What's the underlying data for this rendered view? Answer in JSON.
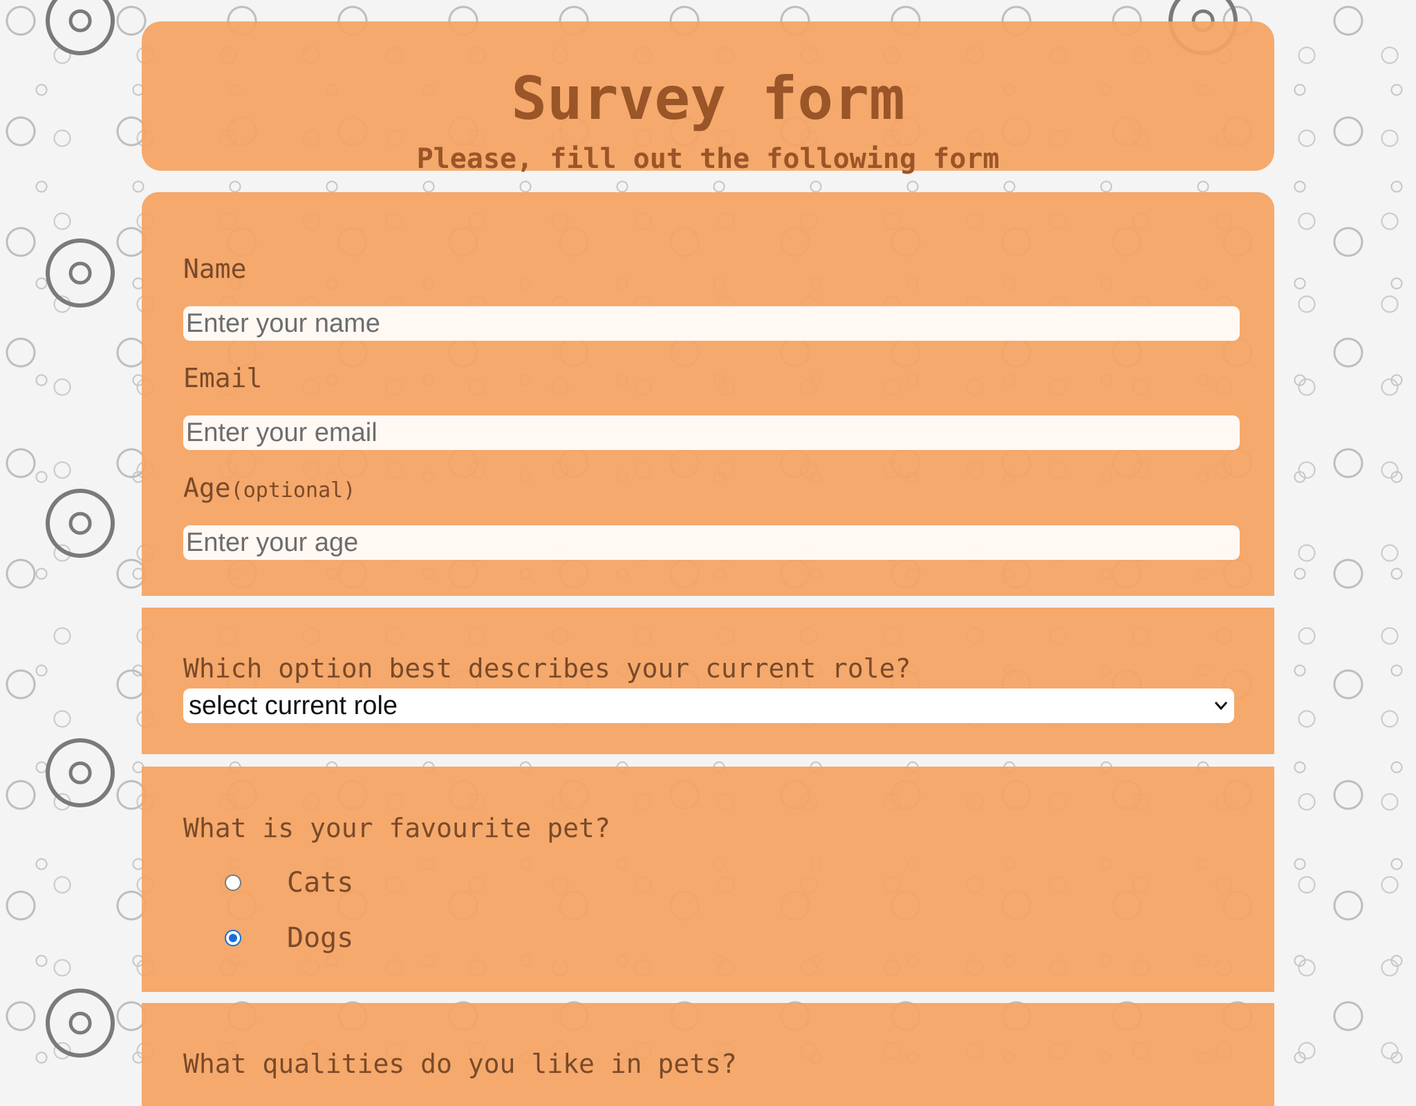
{
  "header": {
    "title": "Survey form",
    "subtitle": "Please, fill out the following form"
  },
  "personal": {
    "name_label": "Name",
    "name_placeholder": "Enter your name",
    "email_label": "Email",
    "email_placeholder": "Enter your email",
    "age_label": "Age",
    "age_optional": "(optional)",
    "age_placeholder": "Enter your age"
  },
  "role": {
    "question": "Which option best describes your current role?",
    "selected": "select current role",
    "chevron_icon": "chevron-down-icon"
  },
  "pet": {
    "question": "What is your favourite pet?",
    "options": [
      {
        "label": "Cats",
        "checked": false
      },
      {
        "label": "Dogs",
        "checked": true
      }
    ]
  },
  "qualities": {
    "question": "What qualities do you like in pets?"
  },
  "colors": {
    "card": "#f4a261",
    "title": "#9a5528",
    "text": "#7a4a2a",
    "radio_checked": "#1a6ed8"
  }
}
